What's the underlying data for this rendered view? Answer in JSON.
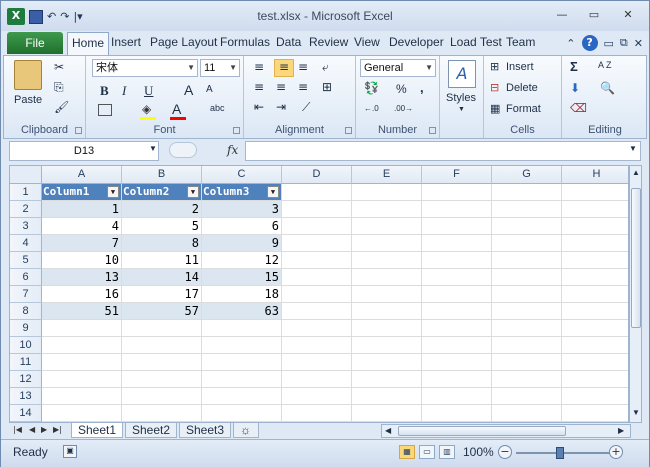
{
  "window": {
    "title": "test.xlsx - Microsoft Excel"
  },
  "qat": {
    "undo": "↶",
    "redo": "↷",
    "customize": "|▾"
  },
  "winctl": {
    "minimize": "—",
    "restore": "▭",
    "close": "✕"
  },
  "tabs": [
    "File",
    "Home",
    "Insert",
    "Page Layout",
    "Formulas",
    "Data",
    "Review",
    "View",
    "Developer",
    "Load Test",
    "Team"
  ],
  "ribbon": {
    "clipboard": {
      "label": "Clipboard",
      "paste": "Paste"
    },
    "font": {
      "label": "Font",
      "name": "宋体",
      "size": "11",
      "bold": "B",
      "italic": "I",
      "underline": "U",
      "grow": "A",
      "shrink": "A",
      "color_a": "A",
      "phonetic": "abc"
    },
    "alignment": {
      "label": "Alignment"
    },
    "number": {
      "label": "Number",
      "format": "General",
      "percent": "%",
      "comma": ",",
      "inc": "←.0",
      "dec": ".00→"
    },
    "styles": {
      "label": "Styles"
    },
    "cells": {
      "label": "Cells",
      "insert": "Insert",
      "delete": "Delete",
      "format": "Format"
    },
    "editing": {
      "label": "Editing",
      "sum": "Σ",
      "sort": "A Z"
    }
  },
  "formula_bar": {
    "name_box": "D13",
    "fx": "fx",
    "formula": ""
  },
  "grid": {
    "columns": [
      "A",
      "B",
      "C",
      "D",
      "E",
      "F",
      "G",
      "H"
    ],
    "rows": [
      "1",
      "2",
      "3",
      "4",
      "5",
      "6",
      "7",
      "8",
      "9",
      "10",
      "11",
      "12",
      "13",
      "14"
    ],
    "headers": [
      "Column1",
      "Column2",
      "Column3"
    ],
    "data": [
      [
        "1",
        "2",
        "3"
      ],
      [
        "4",
        "5",
        "6"
      ],
      [
        "7",
        "8",
        "9"
      ],
      [
        "10",
        "11",
        "12"
      ],
      [
        "13",
        "14",
        "15"
      ],
      [
        "16",
        "17",
        "18"
      ],
      [
        "51",
        "57",
        "63"
      ]
    ]
  },
  "sheets": [
    "Sheet1",
    "Sheet2",
    "Sheet3"
  ],
  "status": {
    "ready": "Ready",
    "zoom": "100%",
    "zoom_minus": "−",
    "zoom_plus": "+"
  },
  "colors": {
    "table_header": "#4f81bd",
    "band": "#dce6f1",
    "file_tab": "#2f8a3c"
  }
}
